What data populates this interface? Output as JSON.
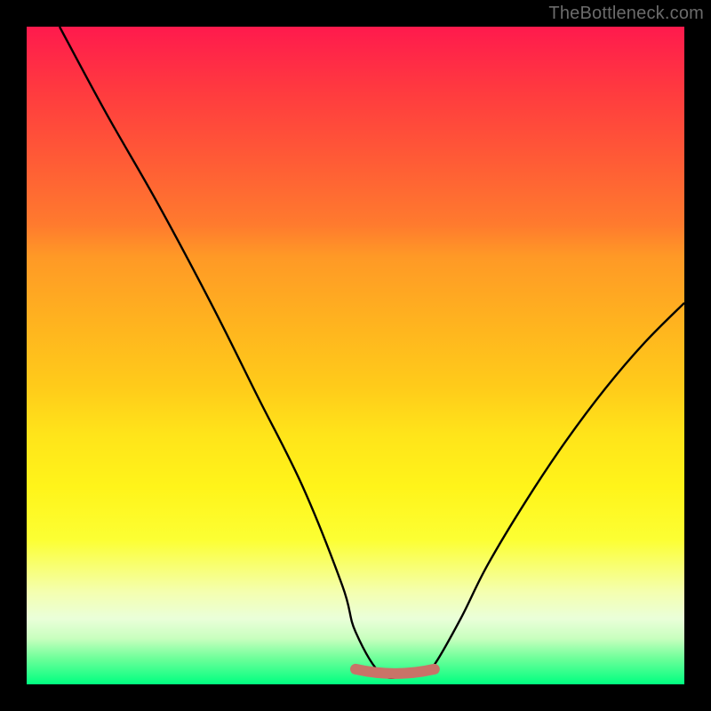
{
  "watermark": "TheBottleneck.com",
  "chart_data": {
    "type": "line",
    "title": "",
    "xlabel": "",
    "ylabel": "",
    "xlim": [
      0,
      100
    ],
    "ylim": [
      0,
      100
    ],
    "grid": false,
    "series": [
      {
        "name": "curve",
        "x": [
          5,
          12,
          20,
          28,
          35,
          42,
          48,
          50,
          54,
          58,
          60,
          62,
          66,
          70,
          76,
          82,
          88,
          94,
          100
        ],
        "y": [
          100,
          87,
          73,
          58,
          44,
          30,
          15,
          8,
          1.5,
          1.5,
          1.5,
          3,
          10,
          18,
          28,
          37,
          45,
          52,
          58
        ]
      }
    ],
    "trough": {
      "x_start": 50,
      "x_end": 62,
      "y": 1.5,
      "color": "#c97368",
      "stroke_width_px": 12
    },
    "background_gradient": {
      "stops": [
        {
          "pos": 0.0,
          "color": "#ff1a4d"
        },
        {
          "pos": 0.1,
          "color": "#ff3b3f"
        },
        {
          "pos": 0.2,
          "color": "#ff5a36"
        },
        {
          "pos": 0.3,
          "color": "#ff7a2e"
        },
        {
          "pos": 0.35,
          "color": "#ff9926"
        },
        {
          "pos": 0.45,
          "color": "#ffb31f"
        },
        {
          "pos": 0.55,
          "color": "#ffcc1a"
        },
        {
          "pos": 0.62,
          "color": "#ffe41a"
        },
        {
          "pos": 0.7,
          "color": "#fff41a"
        },
        {
          "pos": 0.78,
          "color": "#fcff33"
        },
        {
          "pos": 0.86,
          "color": "#f4ffb0"
        },
        {
          "pos": 0.9,
          "color": "#eaffd9"
        },
        {
          "pos": 0.93,
          "color": "#c9ffbf"
        },
        {
          "pos": 0.96,
          "color": "#6fff9a"
        },
        {
          "pos": 1.0,
          "color": "#00ff80"
        }
      ]
    }
  }
}
